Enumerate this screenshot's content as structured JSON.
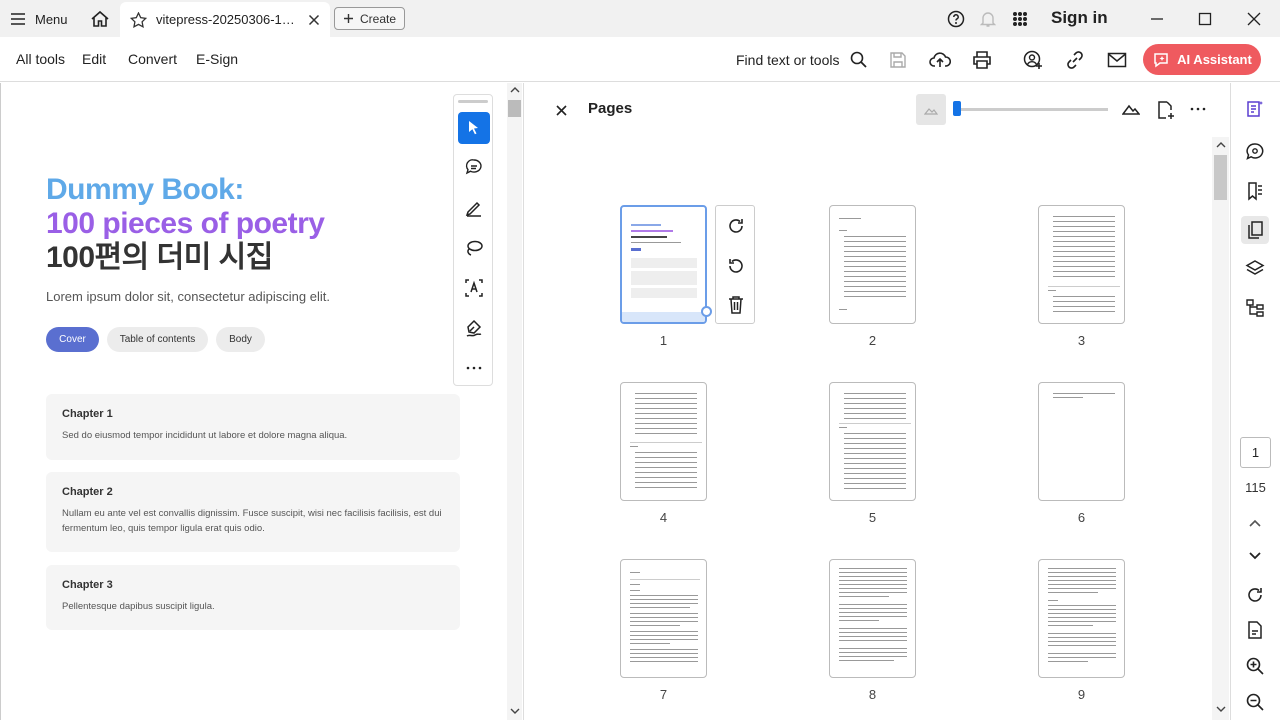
{
  "titlebar": {
    "menu_label": "Menu",
    "tab_title": "vitepress-20250306-103...",
    "create_label": "Create",
    "signin_label": "Sign in"
  },
  "menubar": {
    "items": [
      "All tools",
      "Edit",
      "Convert",
      "E-Sign"
    ],
    "find_label": "Find text or tools",
    "ai_label": "AI Assistant"
  },
  "document": {
    "title_line1": "Dummy Book:",
    "title_line2": "100 pieces of poetry",
    "title_line3": "100편의 더미 시집",
    "subtitle": "Lorem ipsum dolor sit, consectetur adipiscing elit.",
    "pills": [
      "Cover",
      "Table of contents",
      "Body"
    ],
    "chapters": [
      {
        "title": "Chapter 1",
        "text": "Sed do eiusmod tempor incididunt ut labore et dolore magna aliqua."
      },
      {
        "title": "Chapter 2",
        "text": "Nullam eu ante vel est convallis dignissim. Fusce suscipit, wisi nec facilisis facilisis, est dui fermentum leo, quis tempor ligula erat quis odio."
      },
      {
        "title": "Chapter 3",
        "text": "Pellentesque dapibus suscipit ligula."
      }
    ]
  },
  "pages_panel": {
    "title": "Pages",
    "page_numbers": [
      "1",
      "2",
      "3",
      "4",
      "5",
      "6",
      "7",
      "8",
      "9"
    ]
  },
  "navigation": {
    "current_page": "1",
    "total_pages": "115"
  },
  "colors": {
    "accent": "#1473e6",
    "ai_button": "#ef5a5f",
    "title_blue": "#5fa9e8",
    "title_purple": "#9a5fe6",
    "pill_active": "#5a6fd0"
  }
}
